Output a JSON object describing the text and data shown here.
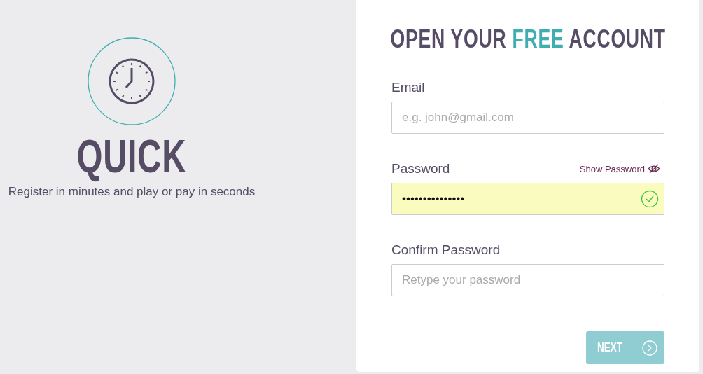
{
  "promo": {
    "headline": "QUICK",
    "tagline": "Register in minutes and play or pay in seconds"
  },
  "form": {
    "title": [
      {
        "text": "OPEN YOUR ",
        "accent": false
      },
      {
        "text": "FREE",
        "accent": true
      },
      {
        "text": " ACCOUNT",
        "accent": false
      }
    ],
    "fields": [
      {
        "label": "Email",
        "placeholder": "e.g. john@gmail.com",
        "valid": false
      },
      {
        "label": "Password",
        "value": "•••••••••••••••",
        "toggle": "Show Password",
        "valid": true
      },
      {
        "label": "Confirm Password",
        "placeholder": "Retype your password",
        "valid": false
      }
    ],
    "next_button": {
      "label": "NEXT",
      "disabled": true
    }
  }
}
